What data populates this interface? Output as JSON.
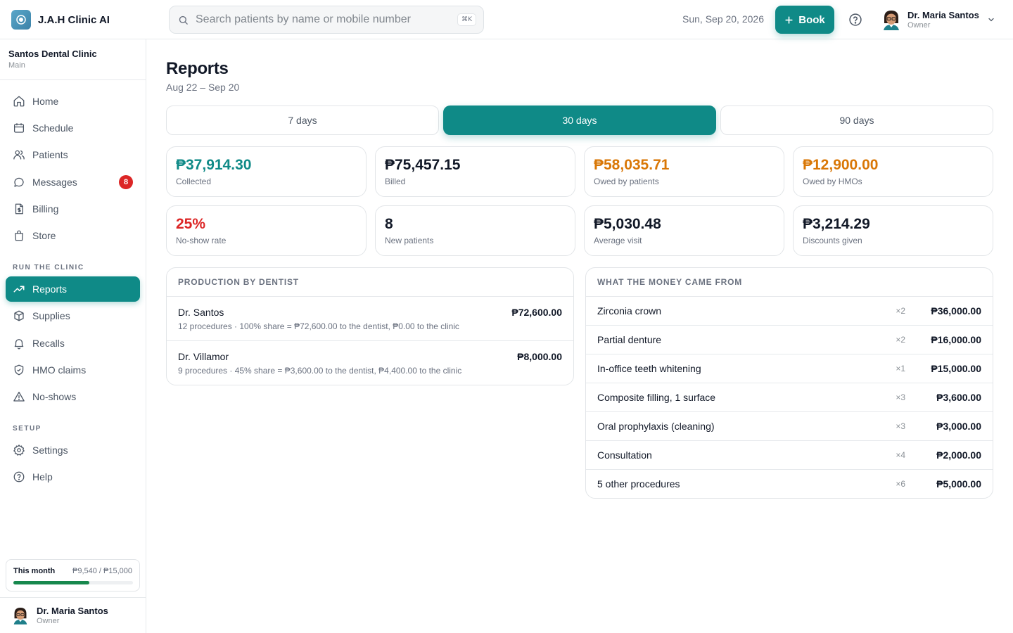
{
  "app": {
    "name": "J.A.H Clinic AI"
  },
  "topbar": {
    "search_placeholder": "Search patients by name or mobile number",
    "search_shortcut": "⌘K",
    "date": "Sun, Sep 20, 2026",
    "book_label": "Book",
    "user_name": "Dr. Maria Santos",
    "user_role": "Owner"
  },
  "sidebar": {
    "clinic_name": "Santos Dental Clinic",
    "clinic_branch": "Main",
    "items": [
      {
        "label": "Home",
        "icon": "home-icon"
      },
      {
        "label": "Schedule",
        "icon": "calendar-icon"
      },
      {
        "label": "Patients",
        "icon": "users-icon"
      },
      {
        "label": "Messages",
        "icon": "message-icon",
        "badge": "8"
      },
      {
        "label": "Billing",
        "icon": "receipt-icon"
      },
      {
        "label": "Store",
        "icon": "shopping-bag-icon"
      }
    ],
    "section_run": "RUN THE CLINIC",
    "run_items": [
      {
        "label": "Reports",
        "icon": "trending-up-icon",
        "active": true
      },
      {
        "label": "Supplies",
        "icon": "box-icon"
      },
      {
        "label": "Recalls",
        "icon": "bell-icon"
      },
      {
        "label": "HMO claims",
        "icon": "shield-icon"
      },
      {
        "label": "No-shows",
        "icon": "warning-icon"
      }
    ],
    "section_setup": "SETUP",
    "setup_items": [
      {
        "label": "Settings",
        "icon": "gear-icon"
      },
      {
        "label": "Help",
        "icon": "help-icon"
      }
    ],
    "month": {
      "label": "This month",
      "value": "₱9,540 / ₱15,000",
      "progress": 0.636
    },
    "user_name": "Dr. Maria Santos",
    "user_role": "Owner"
  },
  "page": {
    "title": "Reports",
    "range": "Aug 22 – Sep 20",
    "ranges": [
      "7 days",
      "30 days",
      "90 days"
    ],
    "active_range": "30 days"
  },
  "stats": [
    {
      "value": "₱37,914.30",
      "label": "Collected",
      "color": "#0f8a87"
    },
    {
      "value": "₱75,457.15",
      "label": "Billed",
      "color": "#111827"
    },
    {
      "value": "₱58,035.71",
      "label": "Owed by patients",
      "color": "#d97706"
    },
    {
      "value": "₱12,900.00",
      "label": "Owed by HMOs",
      "color": "#d97706"
    },
    {
      "value": "25%",
      "label": "No-show rate",
      "color": "#dc2626"
    },
    {
      "value": "8",
      "label": "New patients",
      "color": "#111827"
    },
    {
      "value": "₱5,030.48",
      "label": "Average visit",
      "color": "#111827"
    },
    {
      "value": "₱3,214.29",
      "label": "Discounts given",
      "color": "#111827"
    }
  ],
  "production": {
    "title": "PRODUCTION BY DENTIST",
    "rows": [
      {
        "name": "Dr. Santos",
        "detail": "12 procedures · 100% share = ₱72,600.00 to the dentist, ₱0.00 to the clinic",
        "amount": "₱72,600.00"
      },
      {
        "name": "Dr. Villamor",
        "detail": "9 procedures · 45% share = ₱3,600.00 to the dentist, ₱4,400.00 to the clinic",
        "amount": "₱8,000.00"
      }
    ]
  },
  "money": {
    "title": "WHAT THE MONEY CAME FROM",
    "rows": [
      {
        "name": "Zirconia crown",
        "count": "×2",
        "amount": "₱36,000.00"
      },
      {
        "name": "Partial denture",
        "count": "×2",
        "amount": "₱16,000.00"
      },
      {
        "name": "In-office teeth whitening",
        "count": "×1",
        "amount": "₱15,000.00"
      },
      {
        "name": "Composite filling, 1 surface",
        "count": "×3",
        "amount": "₱3,600.00"
      },
      {
        "name": "Oral prophylaxis (cleaning)",
        "count": "×3",
        "amount": "₱3,000.00"
      },
      {
        "name": "Consultation",
        "count": "×4",
        "amount": "₱2,000.00"
      },
      {
        "name": "5 other procedures",
        "count": "×6",
        "amount": "₱5,000.00"
      }
    ]
  }
}
